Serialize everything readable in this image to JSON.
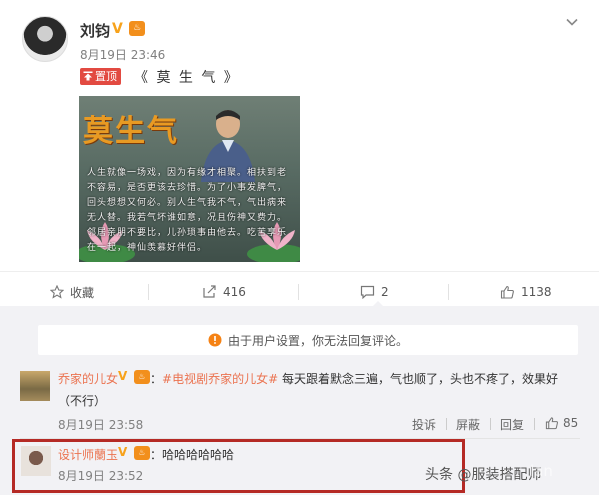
{
  "post": {
    "author": "刘钧",
    "verified_mark": "V",
    "level_badge": "♨",
    "time": "8月19日 23:46",
    "pinned_label": "置顶",
    "title": "《 莫 生 气 》",
    "image": {
      "title": "莫生气",
      "poem": "人生就像一场戏，因为有缘才相聚。相扶到老不容易，是否更该去珍惜。为了小事发脾气，回头想想又何必。别人生气我不气，气出病来无人替。我若气坏谁如意，况且伤神又费力。邻居亲朋不要比，儿孙琐事由他去。吃苦享乐在一起，神仙羡慕好伴侣。"
    }
  },
  "actions": {
    "favorite_label": "收藏",
    "repost_count": "416",
    "comment_count": "2",
    "like_count": "1138"
  },
  "comments": {
    "notice": "由于用户设置，你无法回复评论。",
    "items": [
      {
        "name": "乔家的儿女",
        "verified_mark": "V",
        "level_badge": "♨",
        "tag": "#电视剧乔家的儿女#",
        "text_rest": " 每天跟着默念三遍，气也顺了，头也不疼了，效果好",
        "text_line2": "（不行）",
        "time": "8月19日 23:58",
        "report_label": "投诉",
        "block_label": "屏蔽",
        "reply_label": "回复",
        "like_count": "85"
      },
      {
        "name": "设计师蘭玉",
        "verified_mark": "V",
        "level_badge": "♨",
        "text": "：哈哈哈哈哈哈",
        "time": "8月19日 23:52"
      }
    ]
  },
  "watermark": {
    "text": "头条 @服装搭配师",
    "overlay": "lan"
  },
  "colors": {
    "accent_orange": "#f58214",
    "name_link": "#eb7350",
    "pinned_red": "#e24a41",
    "highlight_box": "#b52a25"
  }
}
